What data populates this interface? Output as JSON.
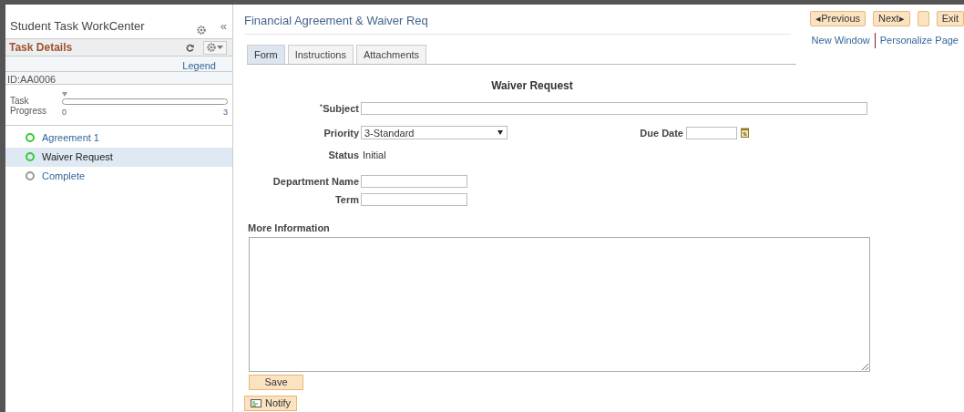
{
  "sidebar": {
    "title": "Student Task WorkCenter",
    "collapse_glyph": "«",
    "section_title": "Task Details",
    "legend_link": "Legend",
    "id_label": "ID:AA0006",
    "progress": {
      "label": "Task Progress",
      "level": 0,
      "min_label": "0",
      "max_label": "3"
    },
    "steps": [
      {
        "label": "Agreement 1",
        "color": "#33cc33",
        "selected": false
      },
      {
        "label": "Waiver Request",
        "color": "#33cc33",
        "selected": true
      },
      {
        "label": "Complete",
        "color": "#999999",
        "selected": false
      }
    ]
  },
  "header": {
    "title": "Financial Agreement & Waiver Req",
    "buttons": [
      {
        "kind": "text",
        "label": "◂Previous"
      },
      {
        "kind": "text",
        "label": "Next▸"
      },
      {
        "kind": "blank"
      },
      {
        "kind": "text",
        "label": "Exit"
      }
    ],
    "links": [
      "New Window",
      "Personalize Page"
    ]
  },
  "tabs": [
    {
      "label": "Form",
      "selected": true
    },
    {
      "label": "Instructions",
      "selected": false
    },
    {
      "label": "Attachments",
      "selected": false
    }
  ],
  "form": {
    "heading": "Waiver Request",
    "required_mark": "*",
    "subject_label": "Subject",
    "priority_label": "Priority",
    "priority_value": "3-Standard",
    "due_date_label": "Due Date",
    "status_label": "Status",
    "status_value": "Initial",
    "department_label": "Department Name",
    "term_label": "Term",
    "more_info_label": "More Information",
    "save_button": "Save",
    "notify_button": "Notify"
  }
}
